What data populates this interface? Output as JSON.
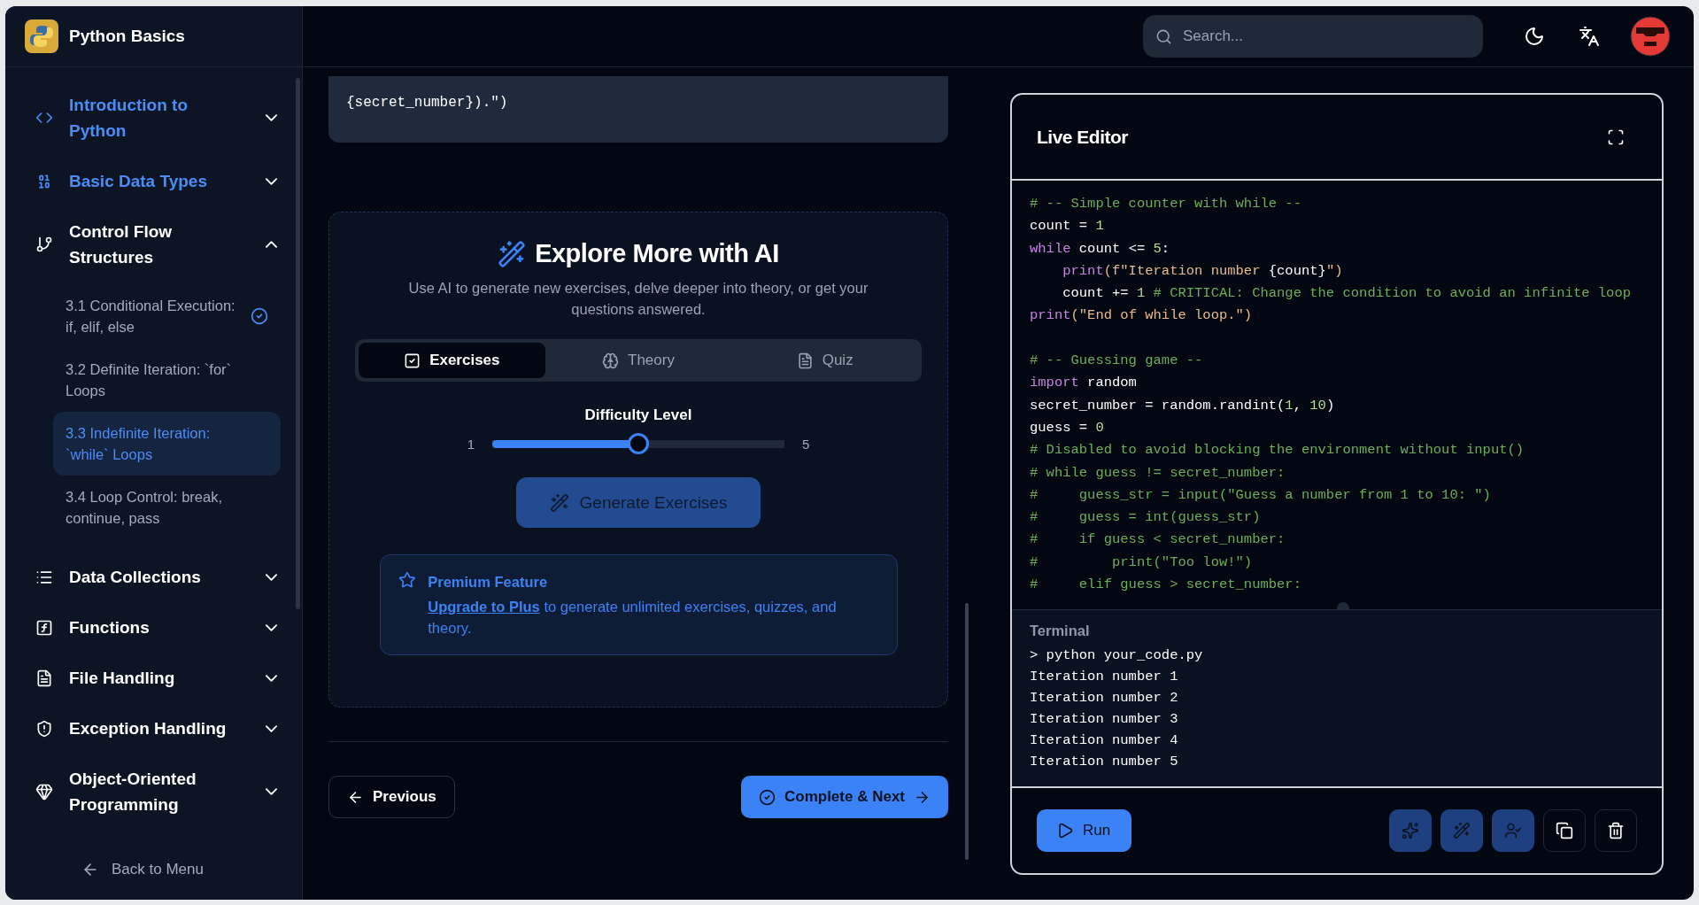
{
  "app": {
    "title": "Python Basics"
  },
  "sidebar": {
    "sections": [
      {
        "title": "Introduction to Python",
        "completed": true,
        "expanded": false
      },
      {
        "title": "Basic Data Types",
        "completed": true,
        "expanded": false
      },
      {
        "title": "Control Flow Structures",
        "completed": false,
        "expanded": true,
        "lessons": [
          {
            "title": "3.1 Conditional Execution: if, elif, else",
            "completed": true,
            "selected": false
          },
          {
            "title": "3.2 Definite Iteration: `for` Loops",
            "completed": false,
            "selected": false
          },
          {
            "title": "3.3 Indefinite Iteration: `while` Loops",
            "completed": false,
            "selected": true
          },
          {
            "title": "3.4 Loop Control: break, continue, pass",
            "completed": false,
            "selected": false
          }
        ]
      },
      {
        "title": "Data Collections",
        "completed": false,
        "expanded": false
      },
      {
        "title": "Functions",
        "completed": false,
        "expanded": false
      },
      {
        "title": "File Handling",
        "completed": false,
        "expanded": false
      },
      {
        "title": "Exception Handling",
        "completed": false,
        "expanded": false
      },
      {
        "title": "Object-Oriented Programming",
        "completed": false,
        "expanded": false
      }
    ],
    "back_link": "Back to Menu"
  },
  "header": {
    "search": {
      "placeholder": "Search..."
    }
  },
  "content": {
    "code_snippet": [
      "{secret_number}).\")"
    ],
    "ai_panel": {
      "title": "Explore More with AI",
      "description": "Use AI to generate new exercises, delve deeper into theory, or get your questions answered.",
      "tabs": [
        {
          "label": "Exercises",
          "selected": true
        },
        {
          "label": "Theory",
          "selected": false
        },
        {
          "label": "Quiz",
          "selected": false
        }
      ],
      "difficulty": {
        "label": "Difficulty Level",
        "min": "1",
        "max": "5",
        "level": 0.5
      },
      "generate_button": {
        "label": "Generate Exercises",
        "disabled": true
      },
      "premium": {
        "title": "Premium Feature",
        "link": "Upgrade to Plus",
        "text": "to generate unlimited exercises, quizzes, and theory."
      }
    },
    "nav": {
      "previous": "Previous",
      "next": "Complete & Next"
    }
  },
  "editor": {
    "title": "Live Editor",
    "code_lines": [
      {
        "kind": "code",
        "tokens": [
          {
            "text": "# -- Simple counter with while --",
            "kind": "comment"
          }
        ]
      },
      {
        "kind": "code",
        "tokens": [
          {
            "text": "count = ",
            "kind": "plain"
          },
          {
            "text": "1",
            "kind": "number"
          }
        ]
      },
      {
        "kind": "code",
        "tokens": [
          {
            "text": "while",
            "kind": "keyword"
          },
          {
            "text": " count <= ",
            "kind": "plain"
          },
          {
            "text": "5",
            "kind": "number"
          },
          {
            "text": ":",
            "kind": "plain"
          }
        ]
      },
      {
        "kind": "code",
        "tokens": [
          {
            "text": "    print",
            "kind": "keyword"
          },
          {
            "text": "(f\"Iteration number ",
            "kind": "string"
          },
          {
            "text": "{count}",
            "kind": "plain"
          },
          {
            "text": "\")",
            "kind": "string"
          }
        ]
      },
      {
        "kind": "code",
        "tokens": [
          {
            "text": "    count += ",
            "kind": "plain"
          },
          {
            "text": "1",
            "kind": "number"
          },
          {
            "text": " # CRITICAL: Change the condition to avoid an infinite loop",
            "kind": "comment"
          }
        ]
      },
      {
        "kind": "code",
        "tokens": [
          {
            "text": "print",
            "kind": "keyword"
          },
          {
            "text": "(\"End of while loop.\")",
            "kind": "string"
          }
        ]
      },
      {
        "kind": "blank"
      },
      {
        "kind": "code",
        "tokens": [
          {
            "text": "# -- Guessing game --",
            "kind": "comment"
          }
        ]
      },
      {
        "kind": "code",
        "tokens": [
          {
            "text": "import",
            "kind": "keyword"
          },
          {
            "text": " random",
            "kind": "plain"
          }
        ]
      },
      {
        "kind": "code",
        "tokens": [
          {
            "text": "secret_number = random.randint(",
            "kind": "plain"
          },
          {
            "text": "1",
            "kind": "number"
          },
          {
            "text": ", ",
            "kind": "plain"
          },
          {
            "text": "10",
            "kind": "number"
          },
          {
            "text": ")",
            "kind": "plain"
          }
        ]
      },
      {
        "kind": "code",
        "tokens": [
          {
            "text": "guess = ",
            "kind": "plain"
          },
          {
            "text": "0",
            "kind": "number"
          }
        ]
      },
      {
        "kind": "code",
        "tokens": [
          {
            "text": "# Disabled to avoid blocking the environment without input()",
            "kind": "comment"
          }
        ]
      },
      {
        "kind": "code",
        "tokens": [
          {
            "text": "# while guess != secret_number:",
            "kind": "comment"
          }
        ]
      },
      {
        "kind": "code",
        "tokens": [
          {
            "text": "#     guess_str = input(\"Guess a number from 1 to 10: \")",
            "kind": "comment"
          }
        ]
      },
      {
        "kind": "code",
        "tokens": [
          {
            "text": "#     guess = int(guess_str)",
            "kind": "comment"
          }
        ]
      },
      {
        "kind": "code",
        "tokens": [
          {
            "text": "#     if guess < secret_number:",
            "kind": "comment"
          }
        ]
      },
      {
        "kind": "code",
        "tokens": [
          {
            "text": "#         print(\"Too low!\")",
            "kind": "comment"
          }
        ]
      },
      {
        "kind": "code",
        "tokens": [
          {
            "text": "#     elif guess > secret_number:",
            "kind": "comment"
          }
        ]
      }
    ],
    "terminal": {
      "title": "Terminal",
      "lines": [
        "> python your_code.py",
        "Iteration number 1",
        "Iteration number 2",
        "Iteration number 3",
        "Iteration number 4",
        "Iteration number 5"
      ]
    },
    "run_button": "Run",
    "actions": [
      {
        "kind": "ai"
      },
      {
        "kind": "ai"
      },
      {
        "kind": "ai"
      },
      {
        "kind": "plain"
      },
      {
        "kind": "plain"
      }
    ]
  }
}
